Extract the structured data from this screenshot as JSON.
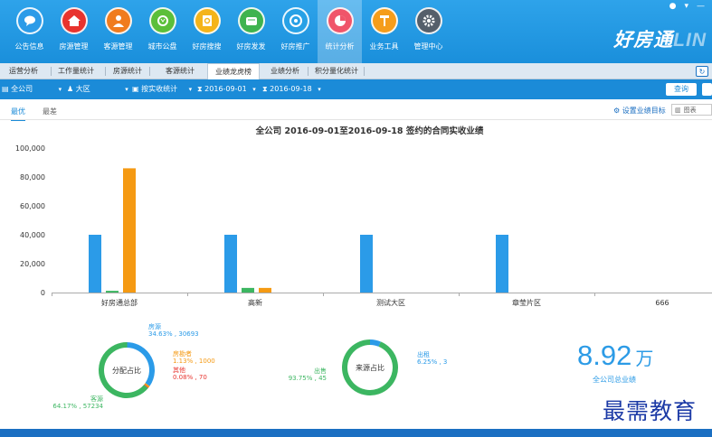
{
  "window": {
    "min_icon": "minimize-icon",
    "menu_icon": "menu-icon",
    "user_icon": "user-icon"
  },
  "brand": {
    "main": "好房通",
    "suffix": "LIN"
  },
  "nav": [
    {
      "label": "公告信息",
      "icon": "chat-icon",
      "color": "#2b9be8"
    },
    {
      "label": "房源管理",
      "icon": "house-icon",
      "color": "#e8332e"
    },
    {
      "label": "客源管理",
      "icon": "person-icon",
      "color": "#f07c1e"
    },
    {
      "label": "城市公盘",
      "icon": "shared-icon",
      "color": "#5bbf3a"
    },
    {
      "label": "好房搜搜",
      "icon": "search-icon",
      "color": "#f4b41a"
    },
    {
      "label": "好房发发",
      "icon": "publish-icon",
      "color": "#3fb34f"
    },
    {
      "label": "好房推广",
      "icon": "promote-icon",
      "color": "#27a1e6"
    },
    {
      "label": "统计分析",
      "icon": "pie-chart-icon",
      "color": "#f0556a",
      "active": true
    },
    {
      "label": "业务工具",
      "icon": "hammer-icon",
      "color": "#f59d1b"
    },
    {
      "label": "管理中心",
      "icon": "gear-icon",
      "color": "#555f6b"
    }
  ],
  "tabs": [
    "运营分析",
    "工作量统计",
    "房源统计",
    "客源统计",
    "业绩龙虎榜",
    "业绩分析",
    "积分量化统计"
  ],
  "active_tab": "业绩龙虎榜",
  "filters": {
    "scope": "全公司",
    "region": "大区",
    "stat_mode": "按实收统计",
    "date_from": "2016-09-01",
    "date_to": "2016-09-18",
    "query": "查询"
  },
  "subtabs": {
    "best": "最优",
    "worst": "最差"
  },
  "target_link": "设置业绩目标",
  "view_toggle": "图表",
  "chart_data": {
    "type": "bar",
    "title": "全公司 2016-09-01至2016-09-18 签约的合同实收业绩",
    "categories": [
      "好房通总部",
      "高新",
      "测试大区",
      "章莹片区",
      "666"
    ],
    "series": [
      {
        "name": "",
        "color": "#2b9be8",
        "values": [
          40000,
          40000,
          40000,
          40000,
          0
        ]
      },
      {
        "name": "",
        "color": "#3cb661",
        "values": [
          1200,
          3200,
          0,
          0,
          0
        ]
      },
      {
        "name": "",
        "color": "#f59a13",
        "values": [
          86000,
          3200,
          0,
          0,
          0
        ]
      }
    ],
    "ylim": [
      0,
      100000
    ],
    "yticks": [
      "0",
      "20,000",
      "40,000",
      "60,000",
      "80,000",
      "100,000"
    ],
    "grid": false
  },
  "donut1": {
    "center": "分配占比",
    "segments": [
      {
        "label": "房源",
        "detail": "34.63% , 30693",
        "fraction": 0.3463,
        "color": "#2b9be8"
      },
      {
        "label": "房勘者",
        "detail": "1.13% , 1000",
        "fraction": 0.0113,
        "color": "#f59a13"
      },
      {
        "label": "其他",
        "detail": "0.08% , 70",
        "fraction": 0.0008,
        "color": "#e8332e"
      },
      {
        "label": "客源",
        "detail": "64.17% , 57234",
        "fraction": 0.6417,
        "color": "#3cb661"
      }
    ]
  },
  "donut2": {
    "center": "来源占比",
    "segments": [
      {
        "label": "出租",
        "detail": "6.25% , 3",
        "fraction": 0.0625,
        "color": "#2b9be8"
      },
      {
        "label": "出售",
        "detail": "93.75% , 45",
        "fraction": 0.9375,
        "color": "#3cb661"
      }
    ]
  },
  "summary": {
    "value": "8.92",
    "unit": "万",
    "caption": "全公司总业绩"
  },
  "watermark": "最需教育"
}
